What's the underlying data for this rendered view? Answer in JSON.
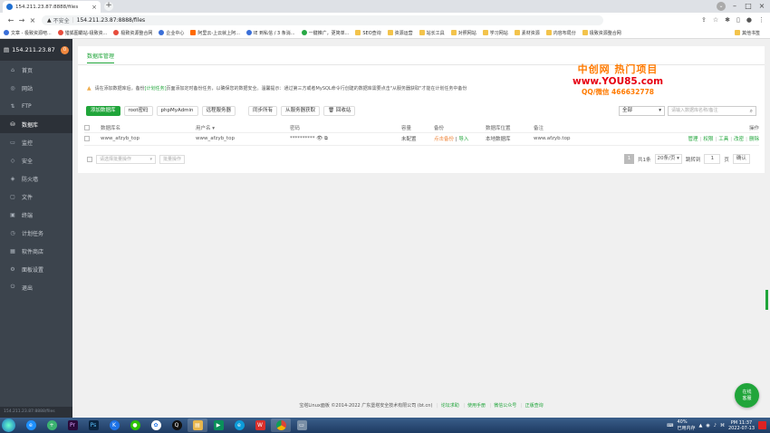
{
  "browser": {
    "tab_title": "154.211.23.87:8888/files",
    "new_tab": "+",
    "insecure_label": "不安全",
    "url": "154.211.23.87:8888/files",
    "bookmarks": [
      "文章 - 极致资源吧...",
      "猎狐图霸站-极致资...",
      "极致资源整合网",
      "企业中心",
      "阿里云-上云就上阿...",
      "IE 到私信 / 3 条消...",
      "一键推广，更简单...",
      "SEO查询",
      "资源运营",
      "站长工具",
      "对照网站",
      "学习网站",
      "素材资源",
      "内容布局分",
      "极致资源整合网"
    ],
    "bookmarks_other": "其他书签"
  },
  "sidebar": {
    "server_ip": "154.211.23.87",
    "badge": "0",
    "items": [
      {
        "label": "首页",
        "icon": "home-icon"
      },
      {
        "label": "网站",
        "icon": "globe-icon"
      },
      {
        "label": "FTP",
        "icon": "ftp-icon"
      },
      {
        "label": "数据库",
        "icon": "database-icon"
      },
      {
        "label": "监控",
        "icon": "monitor-icon"
      },
      {
        "label": "安全",
        "icon": "shield-icon"
      },
      {
        "label": "防火墙",
        "icon": "firewall-icon"
      },
      {
        "label": "文件",
        "icon": "folder-icon"
      },
      {
        "label": "终端",
        "icon": "terminal-icon"
      },
      {
        "label": "计划任务",
        "icon": "clock-icon"
      },
      {
        "label": "软件商店",
        "icon": "store-icon"
      },
      {
        "label": "面板设置",
        "icon": "gear-icon"
      },
      {
        "label": "退出",
        "icon": "logout-icon"
      }
    ],
    "footer_text": "154.211.23.87:8888/files"
  },
  "main": {
    "subtab": "数据库管理",
    "warning": {
      "prefix": "请在添加数据库后，备份",
      "link": "[计划任务]",
      "suffix": "页面添加定时备份任务，以确保您的数据安全。温馨提示：通过第三方或者MySQL命令行创建的数据库需要点击\"从服务器获取\"才能在计划任务中备份"
    },
    "toolbar": {
      "add_db": "添加数据库",
      "root_pw": "root密码",
      "phpmyadmin": "phpMyAdmin",
      "remote": "远程服务器",
      "sync_all": "同步所有",
      "from_server": "从服务器获取",
      "recycle": "回收站"
    },
    "filter": {
      "value": "全部",
      "caret": "▾"
    },
    "search": {
      "placeholder": "请输入数据库名称/备注"
    },
    "table": {
      "headers": [
        "数据库名",
        "用户名 ▾",
        "密码",
        "容量",
        "备份",
        "数据库位置",
        "备注",
        "操作"
      ],
      "rows": [
        {
          "name": "www_afzyb_top",
          "user": "www_afzyb_top",
          "password": "**********",
          "size": "未配置",
          "backup_a": "点击备份",
          "backup_sep": "|",
          "backup_b": "导入",
          "location": "本地数据库",
          "remark": "www.afzyb.top",
          "ops": [
            "管理",
            "权限",
            "工具",
            "改密",
            "删除"
          ]
        }
      ]
    },
    "batch": {
      "select": "请选择批量操作",
      "caret": "▾",
      "exec": "批量操作"
    },
    "pager": {
      "page": "1",
      "total": "共1条",
      "per_page": "20条/页 ▾",
      "jump_label": "跳转到",
      "jump_value": "1",
      "page_unit": "页",
      "confirm": "确认"
    }
  },
  "watermark": {
    "line1": "中创网 热门项目",
    "line2": "www.YOU85.com",
    "line3": "QQ/微信 466632778"
  },
  "footer": {
    "copyright": "宝塔Linux面板 ©2014-2022 广东堡塔安全技术有限公司 (bt.cn)",
    "links": [
      "论坛求助",
      "使用手册",
      "微信公众号",
      "正版查询"
    ]
  },
  "online_service": {
    "line1": "在线",
    "line2": "客服"
  },
  "taskbar": {
    "battery": "40%",
    "battery_status": "已用内存",
    "time": "PM 11:37",
    "date": "2022-07-13"
  },
  "colors": {
    "accent": "#20a53a",
    "sidebar": "#3c444d",
    "warning": "#f0ad4e"
  }
}
